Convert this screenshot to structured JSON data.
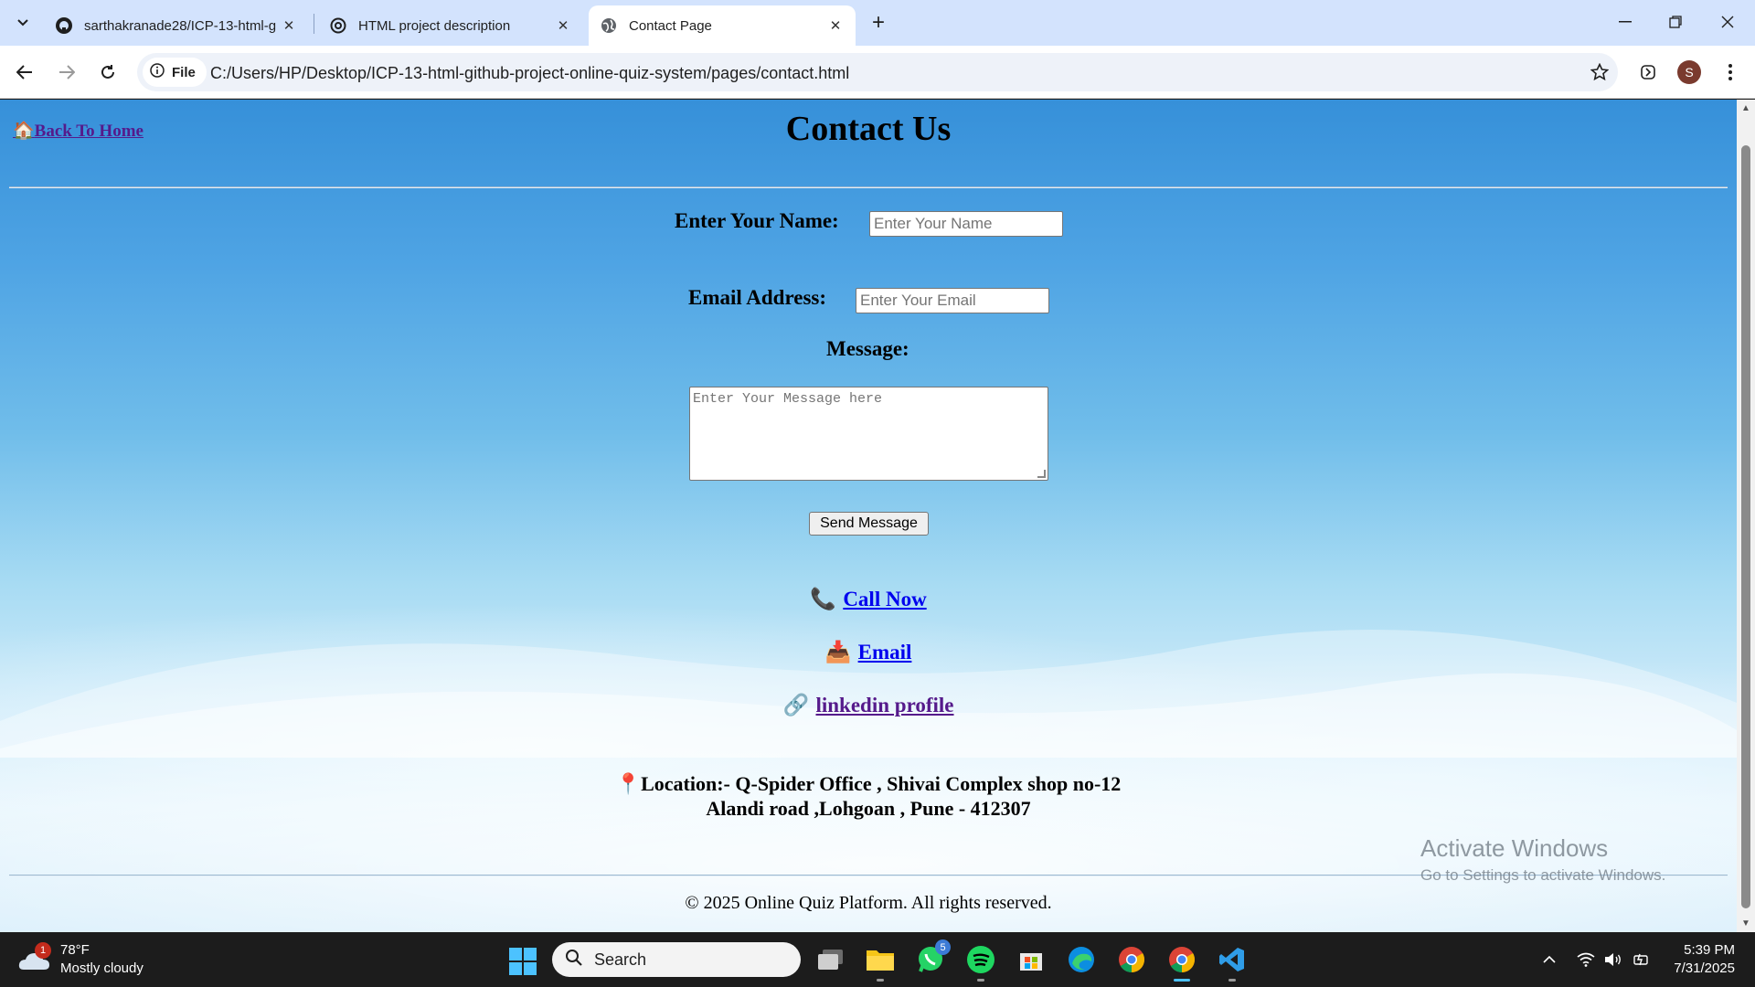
{
  "browser": {
    "tabs": [
      {
        "title": "sarthakranade28/ICP-13-html-g",
        "icon": "github-icon"
      },
      {
        "title": "HTML project description",
        "icon": "openai-icon"
      },
      {
        "title": "Contact Page",
        "icon": "globe-icon",
        "active": true
      }
    ],
    "url_chip": "File",
    "url": "C:/Users/HP/Desktop/ICP-13-html-github-project-online-quiz-system/pages/contact.html",
    "profile_initial": "S"
  },
  "page": {
    "back_link": "Back To Home",
    "back_emoji": "🏠",
    "title": "Contact Us",
    "form": {
      "name_label": "Enter Your Name:",
      "name_placeholder": "Enter Your Name",
      "email_label": "Email Address:",
      "email_placeholder": "Enter Your Email",
      "message_label": "Message:",
      "message_placeholder": "Enter Your Message here",
      "send_label": "Send Message"
    },
    "links": {
      "call": {
        "emoji": "📞",
        "label": "Call Now"
      },
      "email": {
        "emoji": "📥",
        "label": "Email"
      },
      "linkedin": {
        "emoji": "🔗",
        "label": "linkedin profile"
      }
    },
    "location": {
      "emoji": "📍",
      "line1": "Location:- Q-Spider Office , Shivai Complex shop no-12",
      "line2": "Alandi road ,Lohgoan , Pune - 412307"
    },
    "footer": "© 2025 Online Quiz Platform. All rights reserved.",
    "watermark": {
      "line1": "Activate Windows",
      "line2": "Go to Settings to activate Windows."
    }
  },
  "taskbar": {
    "weather_temp": "78°F",
    "weather_desc": "Mostly cloudy",
    "weather_badge": "1",
    "search_placeholder": "Search",
    "whatsapp_badge": "5",
    "time": "5:39 PM",
    "date": "7/31/2025"
  },
  "colors": {
    "link_visited": "#551a8b",
    "link": "#0000ee",
    "accent": "#4cc2ff"
  }
}
